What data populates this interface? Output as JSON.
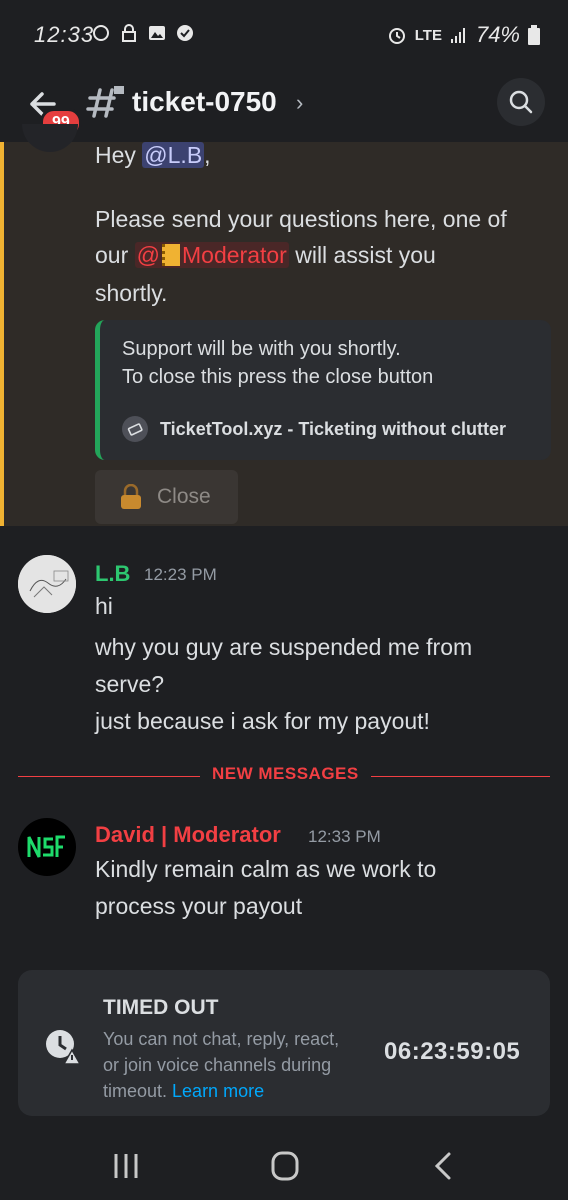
{
  "status_bar": {
    "time": "12:33",
    "network": "LTE",
    "battery": "74%"
  },
  "header": {
    "badge_count": "99",
    "channel_name": "ticket-0750",
    "chevron": "›"
  },
  "bot_message": {
    "greeting_prefix": "Hey ",
    "mention_user": "@L.B",
    "greeting_suffix": ",",
    "line1": "Please send your questions here, one of",
    "line2_prefix": "our ",
    "mention_role_at": "@",
    "mention_role": "Moderator",
    "line2_suffix": " will assist you",
    "line3": "shortly.",
    "embed": {
      "line1": "Support will be with you shortly.",
      "line2": "To close this press the close button",
      "footer": "TicketTool.xyz - Ticketing without clutter",
      "accent": "#23a55a"
    },
    "close_button": "Close"
  },
  "messages": [
    {
      "author": "L.B",
      "author_color": "#2dc770",
      "time": "12:23 PM",
      "lines": [
        "hi",
        "why you guy are suspended me from",
        "serve?",
        "just because i ask for my payout!"
      ]
    },
    {
      "author": "David | Moderator",
      "author_color": "#f23f43",
      "time": "12:33 PM",
      "lines": [
        "Kindly remain calm as we work to",
        "process your payout"
      ]
    }
  ],
  "divider": "NEW MESSAGES",
  "timeout": {
    "title": "TIMED OUT",
    "desc_line1": "You can not chat, reply, react,",
    "desc_line2": "or join voice channels during",
    "desc_line3": "timeout. ",
    "link": "Learn more",
    "timer": "06:23:59:05"
  },
  "colors": {
    "background": "#1e1f22",
    "mention_highlight": "#f0b232",
    "danger": "#f23f43",
    "link": "#00a8fc"
  }
}
